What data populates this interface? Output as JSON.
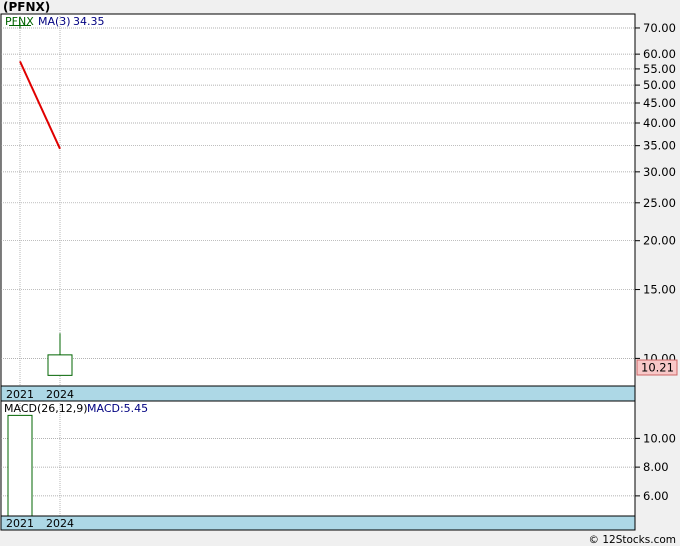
{
  "title": "(PFNX)",
  "credit": "© 12Stocks.com",
  "colors": {
    "background": "#f0f0f0",
    "panel": "#ffffff",
    "candle": "#006400",
    "ma_line": "#e00000",
    "macd_bar": "#006400",
    "axis_bar": "#add8e6",
    "price_tag": "#f8c8c8",
    "grid": "#999999",
    "legend_text": "#000080"
  },
  "chart_data": [
    {
      "type": "candlestick",
      "scale": "log",
      "legend": {
        "symbol": "PFNX",
        "ma_label": "MA(3)",
        "ma_value": "34.35"
      },
      "x_ticks": [
        "2021",
        "2024"
      ],
      "y_ticks": [
        70,
        60,
        55,
        50,
        45,
        40,
        35,
        30,
        25,
        20,
        15,
        10
      ],
      "y_tick_labels": [
        "70.00",
        "60.00",
        "55.00",
        "50.00",
        "45.00",
        "40.00",
        "35.00",
        "30.00",
        "25.00",
        "20.00",
        "15.00",
        "10.00"
      ],
      "ylim": [
        8.5,
        76
      ],
      "last_price_label": "10.21",
      "last_price": 10.21,
      "candles": [
        {
          "x": "2021",
          "open": 71,
          "close": 71,
          "high": 71,
          "low": 71
        },
        {
          "x": "2024",
          "open": 10.21,
          "close": 9.05,
          "high": 11.6,
          "low": 9.05
        }
      ],
      "ma_series": {
        "name": "MA(3)",
        "x": [
          "2021",
          "2024"
        ],
        "values": [
          57.5,
          34.35
        ]
      }
    },
    {
      "type": "bar",
      "legend": {
        "label": "MACD(26,12,9)",
        "value_label": "MACD:5.45"
      },
      "x_ticks": [
        "2021",
        "2024"
      ],
      "y_ticks": [
        10,
        8,
        6
      ],
      "y_tick_labels": [
        "10.00",
        "8.00",
        "6.00"
      ],
      "ylim": [
        4.6,
        12.6
      ],
      "bars": [
        {
          "x": "2021",
          "value": 11.6
        }
      ]
    }
  ]
}
